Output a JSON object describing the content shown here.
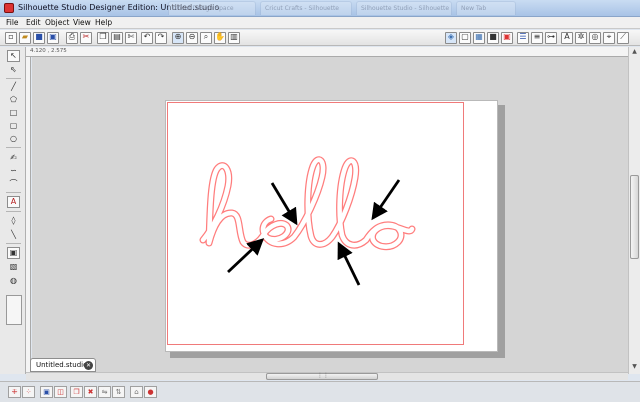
{
  "window": {
    "title": "Silhouette Studio Designer Edition: Untitled.studio",
    "background_tabs": [
      "Cricut Design Space",
      "Cricut Crafts - Silhouette",
      "Silhouette Studio - Silhouette",
      "New Tab"
    ]
  },
  "menu": {
    "items": [
      "File",
      "Edit",
      "Object",
      "View",
      "Help"
    ]
  },
  "ruler": {
    "coord_readout": "4.120 , 2.575"
  },
  "canvas": {
    "artwork_text": "hello",
    "cut_line_color": "#f07a7a",
    "arrow_count": 4
  },
  "document_tab": {
    "label": "Untitled.studio"
  },
  "colors": {
    "accent": "#d33333",
    "canvas_bg": "#d5d5d5",
    "paper": "#ffffff"
  },
  "icons": {
    "toolbar_left": [
      "new-icon",
      "open-icon",
      "save-icon",
      "save-as-icon",
      "print-icon",
      "cut-icon",
      "copy-icon",
      "paste-icon",
      "undo-icon",
      "redo-icon",
      "zoom-in-icon",
      "zoom-out-icon",
      "zoom-select-icon",
      "pan-icon",
      "fit-page-icon"
    ],
    "toolbar_right": [
      "fill-icon",
      "line-icon",
      "gradient-icon",
      "pattern-icon",
      "color-icon",
      "line-style-icon",
      "align-icon",
      "replicate-icon",
      "text-style-icon",
      "transform-icon",
      "offset-icon",
      "trace-icon",
      "knife-icon"
    ],
    "left_tools": [
      "select-icon",
      "point-edit-icon",
      "line-icon",
      "polygon-icon",
      "rectangle-icon",
      "rounded-rect-icon",
      "ellipse-icon",
      "freehand-icon",
      "curve-icon",
      "arc-icon",
      "text-icon",
      "eraser-icon",
      "knife-icon"
    ],
    "bottom_tools": [
      "group-icon",
      "ungroup-icon",
      "compound-icon",
      "release-compound-icon",
      "duplicate-icon",
      "delete-icon",
      "mirror-icon",
      "flip-icon",
      "bring-forward-icon",
      "send-back-icon",
      "weld-icon",
      "stop-icon"
    ]
  }
}
